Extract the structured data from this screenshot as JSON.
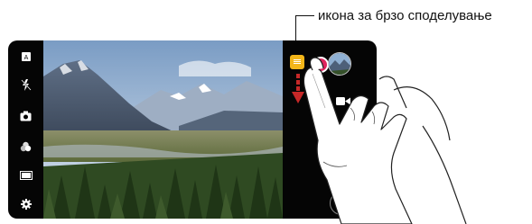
{
  "callout": {
    "label": "икона за брзо споделување"
  },
  "left_bar": {
    "icons": [
      "mode-icon",
      "flash-off-icon",
      "camera-switch-icon",
      "filter-icon",
      "aspect-ratio-icon",
      "settings-icon"
    ]
  },
  "right_panel": {
    "icons": [
      "quick-share-icon",
      "record-icon",
      "gallery-thumbnail",
      "video-icon",
      "shutter-icon",
      "back-icon"
    ]
  },
  "colors": {
    "quick_share": "#f3b619",
    "record": "#e0245e",
    "arrow": "#c62828"
  }
}
